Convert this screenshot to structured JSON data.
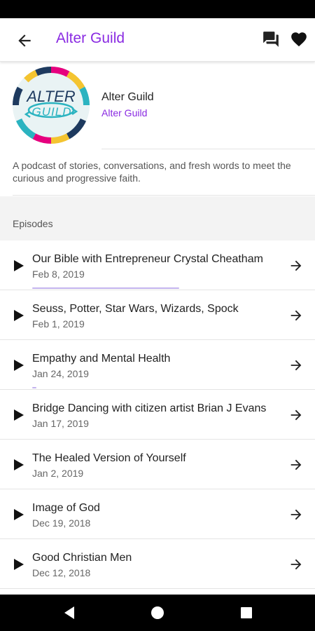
{
  "app_bar": {
    "title": "Alter Guild",
    "back_icon": "arrow-back-icon",
    "actions": [
      "chat-icon",
      "heart-icon"
    ],
    "accent_color": "#8a2be2"
  },
  "podcast": {
    "cover_text_top": "ALTER",
    "cover_text_bottom": "GUILD",
    "name": "Alter Guild",
    "author": "Alter Guild",
    "description": "A podcast of stories, conversations, and fresh words to meet the curious and progressive faith."
  },
  "episodes_label": "Episodes",
  "episodes": [
    {
      "title": "Our Bible with Entrepreneur Crystal Cheatham",
      "date": "Feb 8, 2019",
      "progress": 0.75
    },
    {
      "title": "Seuss, Potter, Star Wars, Wizards, Spock",
      "date": "Feb 1, 2019",
      "progress": 0
    },
    {
      "title": "Empathy and Mental Health",
      "date": "Jan 24, 2019",
      "progress": 0.02
    },
    {
      "title": "Bridge Dancing with citizen artist Brian J Evans",
      "date": "Jan 17, 2019",
      "progress": 0
    },
    {
      "title": "The Healed Version of Yourself",
      "date": "Jan 2, 2019",
      "progress": 0
    },
    {
      "title": "Image of God",
      "date": "Dec 19, 2018",
      "progress": 0
    },
    {
      "title": "Good Christian Men",
      "date": "Dec 12, 2018",
      "progress": 0
    }
  ],
  "nav_bar": {
    "buttons": [
      "nav-back-icon",
      "nav-home-icon",
      "nav-recents-icon"
    ]
  }
}
